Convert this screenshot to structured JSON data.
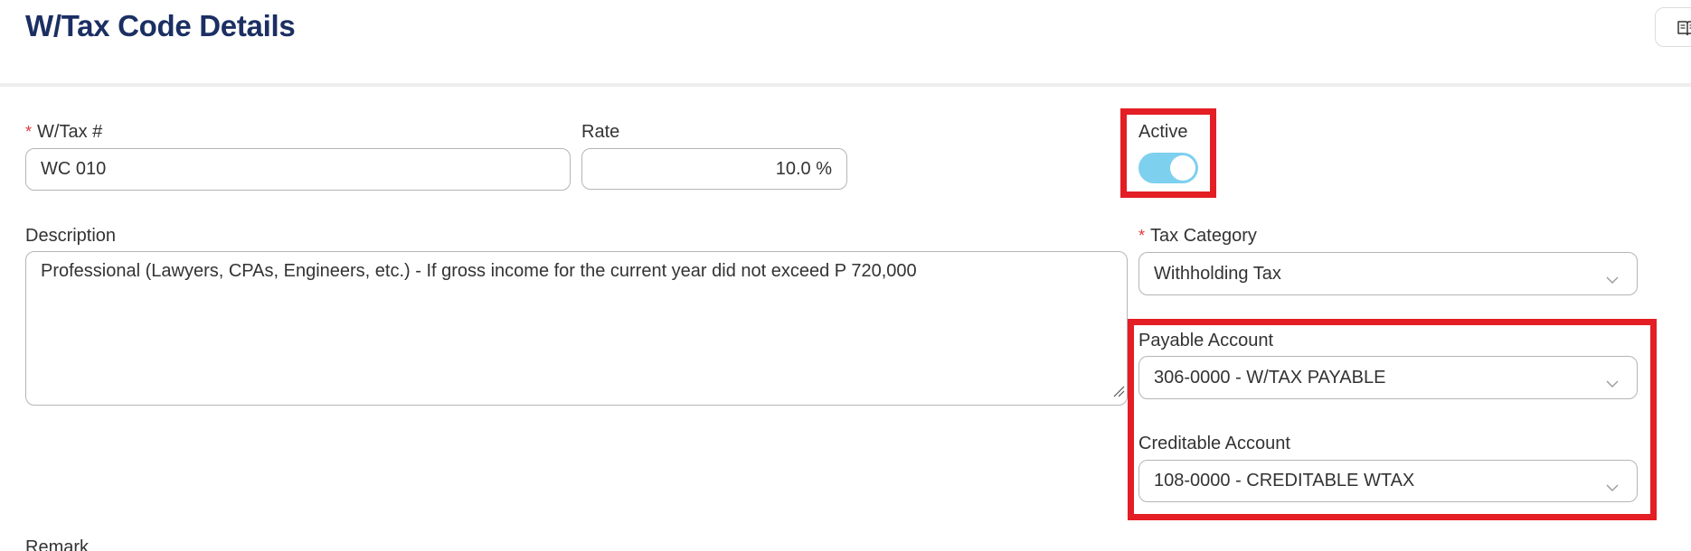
{
  "header": {
    "title": "W/Tax Code Details",
    "top_button_icon": "book-icon"
  },
  "form": {
    "wtax_number": {
      "label": "W/Tax #",
      "required": true,
      "value": "WC 010"
    },
    "rate": {
      "label": "Rate",
      "value": "10.0 %"
    },
    "active": {
      "label": "Active",
      "checked": true
    },
    "description": {
      "label": "Description",
      "value": "Professional (Lawyers, CPAs, Engineers, etc.) - If gross income for the current year did not exceed P 720,000"
    },
    "tax_category": {
      "label": "Tax Category",
      "required": true,
      "value": "Withholding Tax"
    },
    "payable_account": {
      "label": "Payable Account",
      "value": "306-0000 - W/TAX PAYABLE"
    },
    "creditable_account": {
      "label": "Creditable Account",
      "value": "108-0000 - CREDITABLE WTAX"
    },
    "remark": {
      "label": "Remark"
    },
    "required_marker": "*"
  },
  "colors": {
    "title": "#1b2f63",
    "toggle_on": "#7ed0ef",
    "highlight": "#e31e24",
    "required": "#e23a3a"
  }
}
